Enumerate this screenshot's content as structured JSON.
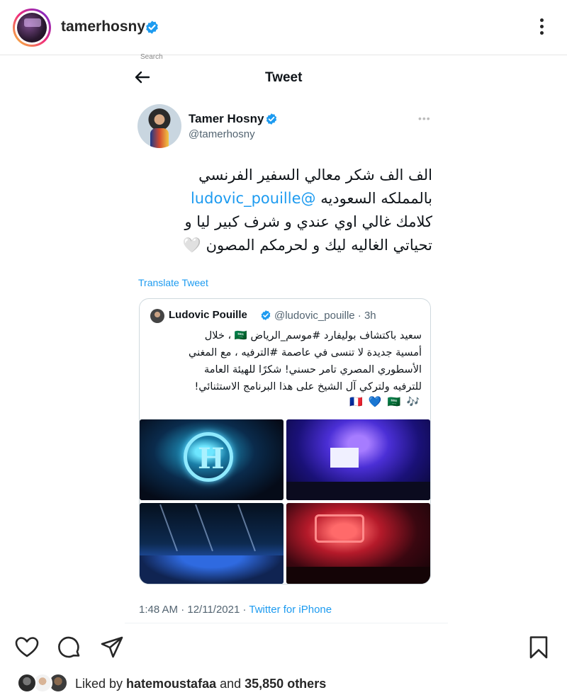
{
  "post_header": {
    "username": "tamerhosny",
    "verified_icon": "verified-badge-icon",
    "more_icon": "more-vertical-icon"
  },
  "tweet": {
    "screen_title": "Tweet",
    "search_stub": "Search",
    "author_name": "Tamer Hosny",
    "author_handle": "@tamerhosny",
    "text_lines": [
      "الف الف شكر معالي السفير الفرنسي",
      "بالمملكه السعوديه ",
      "كلامك غالي اوي عندي و شرف كبير ليا و",
      "تحياتي الغاليه ليك و لحرمكم المصون "
    ],
    "mention": "@ludovic_pouille",
    "heart_emoji": "🤍",
    "translate_label": "Translate Tweet",
    "quoted": {
      "author_name": "Ludovic Pouille",
      "handle_time": "@ludovic_pouille · 3h",
      "text_lines": [
        "سعيد باكتشاف بوليفارد #موسم_الرياض 🇸🇦 ، خلال",
        "أمسية جديدة لا تنسى في عاصمة #الترفيه ، مع المغني",
        "الأسطوري المصري تامر حسني! شكرًا للهيئة العامة",
        "للترفيه ولتركي آل الشيخ على هذا البرنامج الاستثنائي!"
      ],
      "emoji_line": "🇫🇷 💙 🇸🇦 🎶",
      "image_names": [
        "concert-photo-1",
        "concert-photo-2",
        "concert-photo-3",
        "concert-photo-4"
      ]
    },
    "timestamp": "1:48 AM · 12/11/2021 · ",
    "source": "Twitter for iPhone"
  },
  "actions": {
    "like_icon": "heart-icon",
    "comment_icon": "comment-icon",
    "share_icon": "send-icon",
    "save_icon": "bookmark-icon"
  },
  "likes": {
    "prefix": "Liked by ",
    "user": "hatemoustafaa",
    "middle": " and ",
    "count": "35,850 others"
  },
  "colors": {
    "twitter_blue": "#1d9bf0",
    "verified_blue": "#1d9bf0",
    "text_primary": "#262626"
  }
}
